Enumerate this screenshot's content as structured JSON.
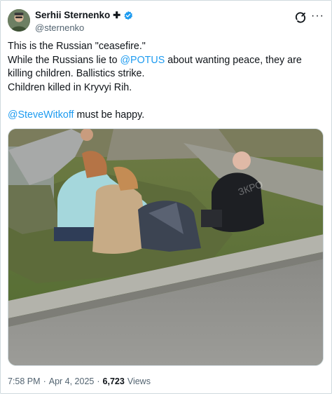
{
  "author": {
    "display_name": "Serhii Sternenko",
    "handle": "@sternenko"
  },
  "tweet": {
    "line1": "This is the Russian \"ceasefire.\"",
    "line2_pre": "While the Russians lie to ",
    "mention1": "@POTUS",
    "line2_post": " about wanting peace, they are killing children. Ballistics strike.",
    "line3": "Children killed in Kryvyi Rih.",
    "mention2": "@SteveWitkoff",
    "line4_post": " must be happy."
  },
  "media": {
    "watermark": "ЗКРО"
  },
  "meta": {
    "time": "7:58 PM",
    "separator1": "·",
    "date": "Apr 4, 2025",
    "separator2": "·",
    "views_count": "6,723",
    "views_label": "Views"
  },
  "colors": {
    "link": "#1d9bf0",
    "verified": "#1d9bf0",
    "secondary_text": "#536471"
  }
}
